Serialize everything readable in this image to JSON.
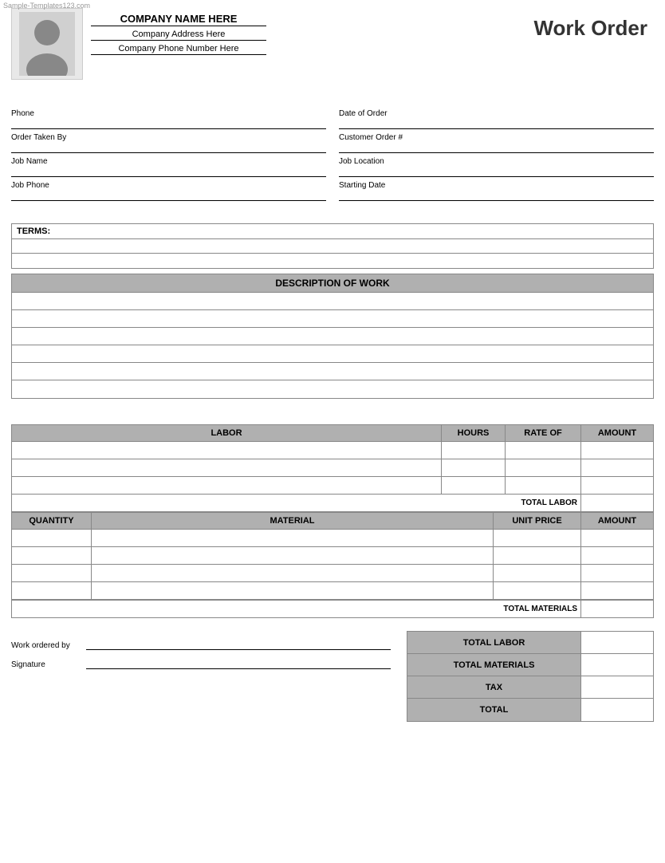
{
  "watermark": "Sample-Templates123.com",
  "header": {
    "company_name": "COMPANY NAME HERE",
    "company_address": "Company Address Here",
    "company_phone": "Company Phone Number Here",
    "title": "Work Order"
  },
  "form": {
    "phone_label": "Phone",
    "order_taken_label": "Order Taken By",
    "job_name_label": "Job Name",
    "job_phone_label": "Job Phone",
    "date_of_order_label": "Date of Order",
    "customer_order_label": "Customer Order #",
    "job_location_label": "Job Location",
    "starting_date_label": "Starting Date"
  },
  "terms": {
    "header": "TERMS:"
  },
  "description_of_work": {
    "header": "DESCRIPTION OF WORK"
  },
  "labor_table": {
    "col_labor": "LABOR",
    "col_hours": "HOURS",
    "col_rate": "RATE OF",
    "col_amount": "AMOUNT",
    "total_label": "TOTAL LABOR"
  },
  "materials_table": {
    "col_quantity": "QUANTITY",
    "col_material": "MATERIAL",
    "col_unit_price": "UNIT PRICE",
    "col_amount": "AMOUNT",
    "total_label": "TOTAL MATERIALS"
  },
  "summary": {
    "total_labor_label": "TOTAL LABOR",
    "total_materials_label": "TOTAL MATERIALS",
    "tax_label": "TAX",
    "total_label": "TOTAL"
  },
  "bottom": {
    "work_ordered_by_label": "Work ordered by",
    "signature_label": "Signature"
  }
}
